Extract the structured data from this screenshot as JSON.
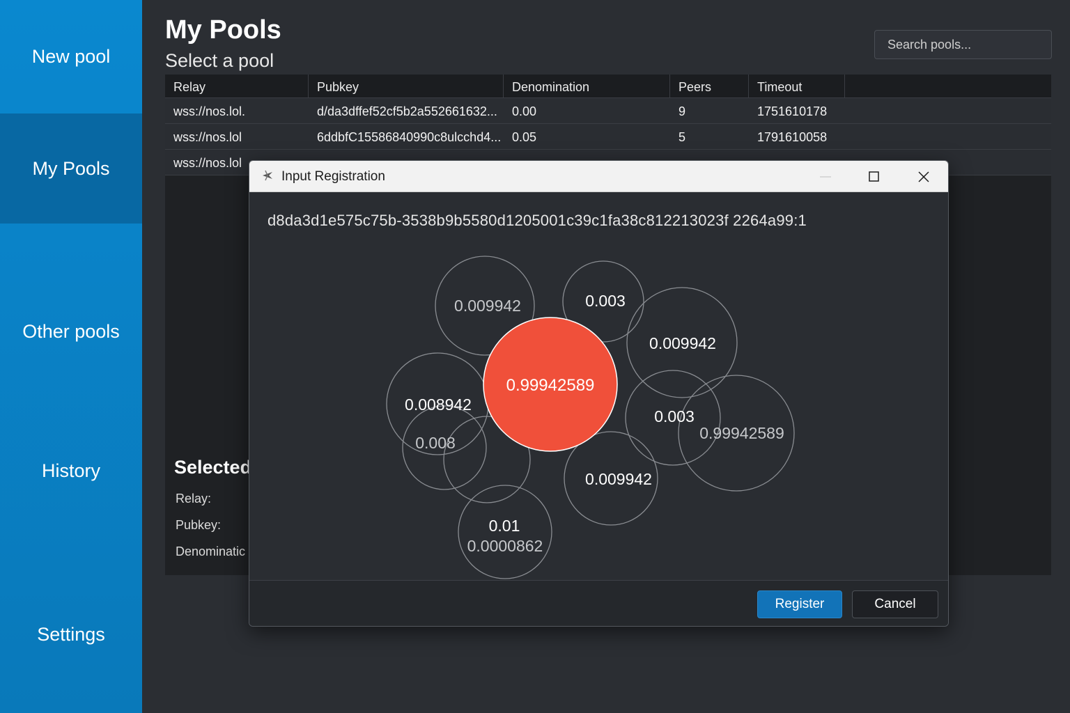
{
  "sidebar": {
    "items": [
      {
        "label": "New pool"
      },
      {
        "label": "My Pools"
      },
      {
        "label": "Other pools"
      },
      {
        "label": "History"
      },
      {
        "label": "Settings"
      }
    ]
  },
  "header": {
    "title": "My Pools",
    "subtitle": "Select a pool"
  },
  "search": {
    "placeholder": "Search pools..."
  },
  "table": {
    "columns": [
      "Relay",
      "Pubkey",
      "Denomination",
      "Peers",
      "Timeout"
    ],
    "rows": [
      [
        "wss://nos.lol.",
        "d/da3dffef52cf5b2a552661632...",
        "0.00",
        "9",
        "1751610178"
      ],
      [
        "wss://nos.lol",
        "6ddbfC15586840990c8ulcchd4...",
        "0.05",
        "5",
        "1791610058"
      ],
      [
        "wss://nos.lol",
        "",
        "",
        "",
        ""
      ]
    ]
  },
  "selected": {
    "title": "Selected",
    "relay_label": "Relay:",
    "pubkey_label": "Pubkey:",
    "denomination_label": "Denominatic"
  },
  "dialog": {
    "title": "Input Registration",
    "outpoint": "d8da3d1e575c75b-3538b9b5580d1205001c39c1fa38c812213023f 2264a99:1",
    "highlight_color": "#f0503a",
    "bubbles": [
      {
        "label": "0.009942",
        "highlight": false
      },
      {
        "label": "0.003",
        "highlight": false
      },
      {
        "label": "0.009942",
        "highlight": false
      },
      {
        "label": "0.008942",
        "highlight": false
      },
      {
        "label": "0.008",
        "highlight": false
      },
      {
        "label": "",
        "highlight": false
      },
      {
        "label": "0.003",
        "highlight": false
      },
      {
        "label": "0.99942589",
        "highlight": false
      },
      {
        "label": "0.009942",
        "highlight": false
      },
      {
        "label": "0.01",
        "sublabel": "0.0000862",
        "highlight": false
      },
      {
        "label": "0.99942589",
        "highlight": true
      }
    ],
    "register_label": "Register",
    "cancel_label": "Cancel"
  }
}
